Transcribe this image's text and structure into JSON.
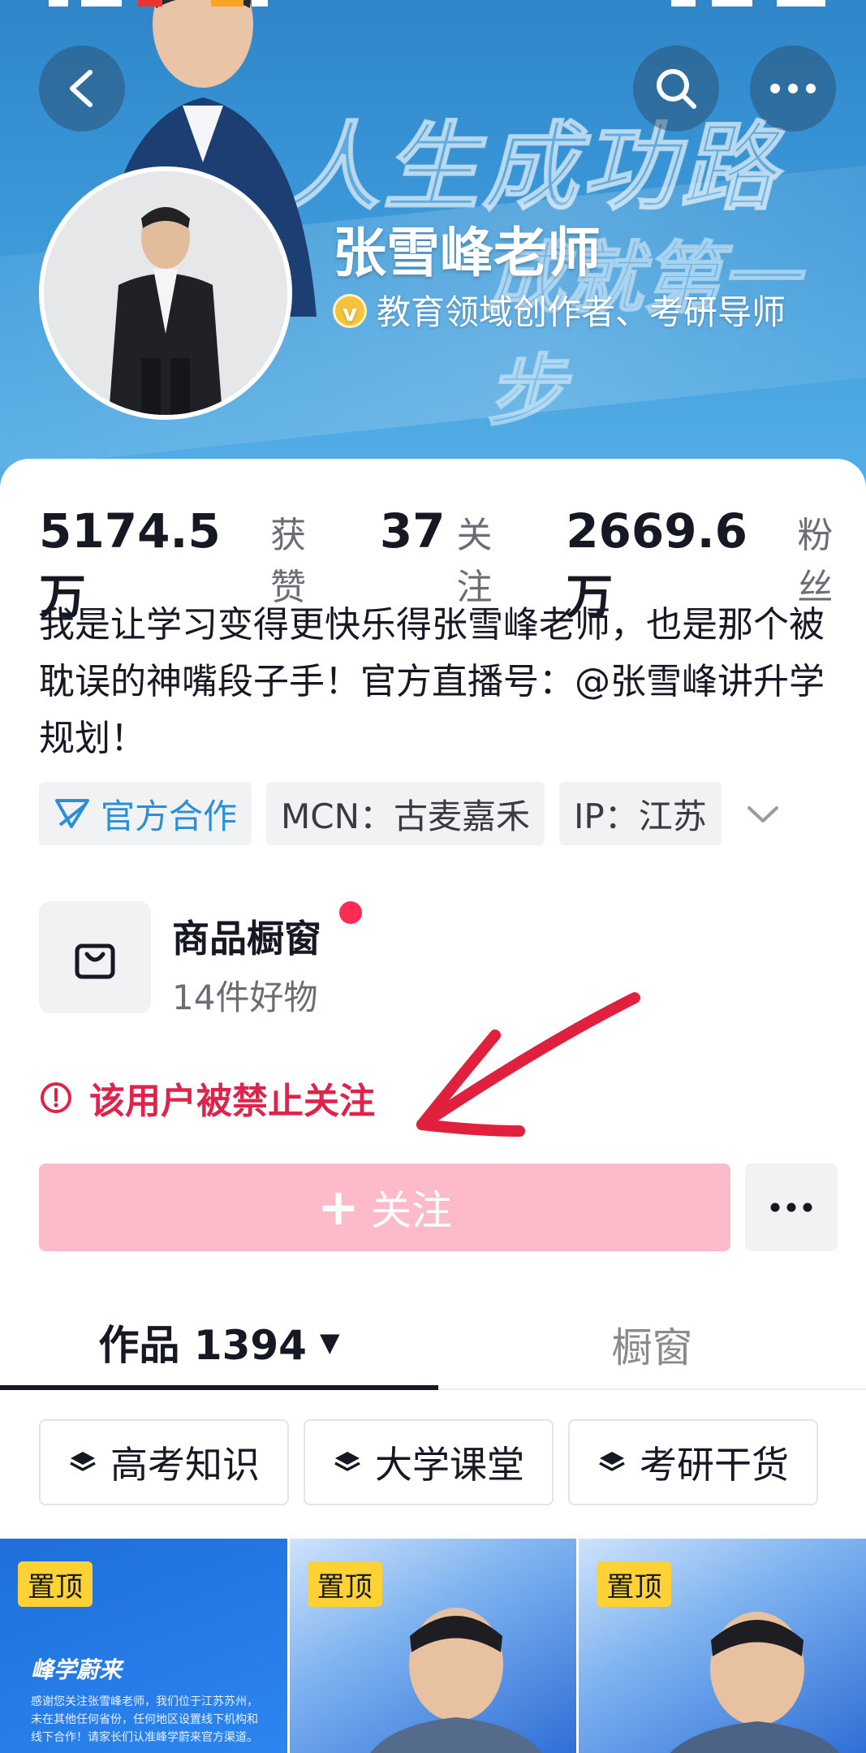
{
  "banner": {
    "slogan_line1": "人生成功路",
    "slogan_line2": "成就第一步"
  },
  "profile": {
    "name": "张雪峰老师",
    "verified_icon_letter": "v",
    "verification": "教育领域创作者、考研导师"
  },
  "stats": {
    "likes_value": "5174.5万",
    "likes_label": "获赞",
    "following_value": "37",
    "following_label": "关注",
    "followers_value": "2669.6万",
    "followers_label": "粉丝"
  },
  "bio": "我是让学习变得更快乐得张雪峰老师，也是那个被耽误的神嘴段子手！官方直播号：@张雪峰讲升学规划！",
  "tags": {
    "official": "官方合作",
    "mcn": "MCN：古麦嘉禾",
    "ip": "IP：江苏"
  },
  "shop": {
    "title": "商品橱窗",
    "subtitle": "14件好物"
  },
  "notice": {
    "text": "该用户被禁止关注"
  },
  "follow": {
    "plus": "+",
    "label": "关注"
  },
  "tabs": {
    "works_label": "作品 1394",
    "window_label": "橱窗"
  },
  "collections": [
    {
      "label": "高考知识"
    },
    {
      "label": "大学课堂"
    },
    {
      "label": "考研干货"
    }
  ],
  "videos": [
    {
      "badge": "置顶",
      "logo": "峰学蔚来",
      "note": "感谢您关注张雪峰老师，我们位于江苏苏州，未在其他任何省份，任何地区设置线下机构和线下合作！请家长们认准峰学蔚来官方渠道。"
    },
    {
      "badge": "置顶"
    },
    {
      "badge": "置顶"
    }
  ],
  "colors": {
    "accent": "#fe2c55",
    "follow_disabled": "#fdbac8",
    "warning": "#e0234a",
    "official_tag": "#2a8fd8",
    "pin_badge": "#fed234"
  },
  "icons": {
    "back": "back-arrow-icon",
    "search": "search-icon",
    "more": "more-dots-icon",
    "verified": "verified-v-icon",
    "official": "official-cooperation-icon",
    "expand": "chevron-down-icon",
    "shop": "shopping-bag-icon",
    "warning": "warning-circle-icon",
    "collection": "layers-icon"
  }
}
